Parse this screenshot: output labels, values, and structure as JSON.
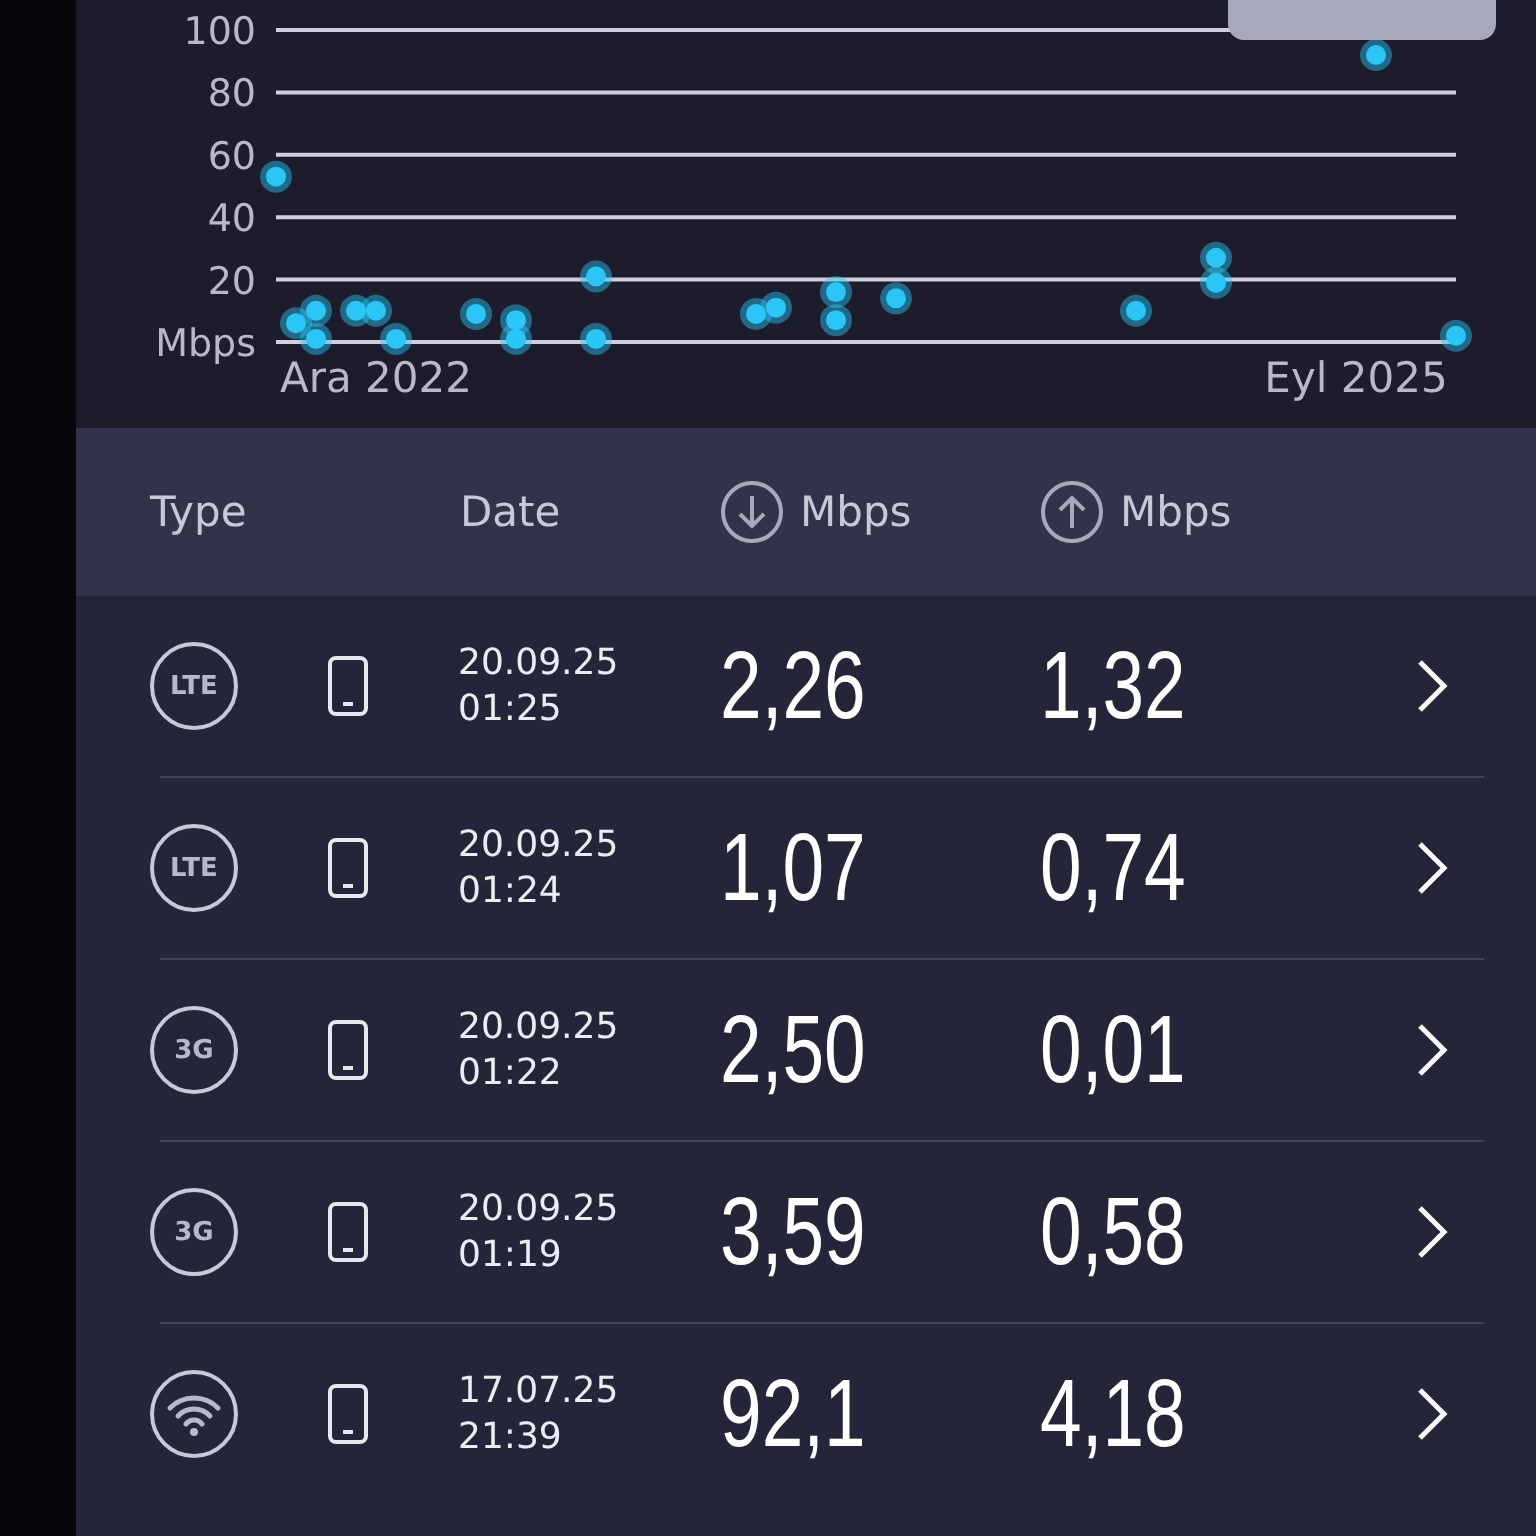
{
  "chart": {
    "chart_data": {
      "type": "scatter",
      "grid": true,
      "categories": [
        null,
        null,
        null,
        null,
        null,
        "Ara 2022",
        null,
        null,
        null,
        null,
        null,
        null,
        null,
        null,
        null,
        null,
        null,
        null,
        null,
        null,
        null,
        null,
        null,
        null,
        null,
        null,
        null,
        null,
        null,
        null,
        null,
        null,
        null,
        null,
        null,
        null,
        null,
        null,
        null,
        null,
        null,
        null,
        null,
        null,
        null,
        null,
        null,
        null,
        null,
        null,
        null,
        null,
        null,
        null,
        "Eyl 2025",
        null,
        null,
        null,
        null,
        null
      ],
      "yticks": [
        {
          "value": 0,
          "label": "Mbps"
        },
        20,
        40,
        60,
        80,
        100
      ],
      "ylim": [
        0,
        100
      ],
      "series": [
        {
          "color": "#2bc6f7",
          "values": [
            53,
            6,
            10,
            null,
            10,
            10,
            1,
            null,
            null,
            null,
            9,
            null,
            7,
            null,
            null,
            null,
            21,
            null,
            null,
            null,
            null,
            null,
            null,
            null,
            9,
            11,
            null,
            null,
            16,
            null,
            null,
            14,
            null,
            null,
            null,
            null,
            null,
            null,
            null,
            null,
            null,
            null,
            null,
            10,
            null,
            null,
            null,
            27,
            null,
            null,
            null,
            null,
            null,
            null,
            null,
            92,
            null,
            null,
            null,
            2
          ]
        },
        {
          "color": "#2bc6f7",
          "values": [
            null,
            null,
            1,
            null,
            null,
            null,
            null,
            null,
            null,
            null,
            null,
            null,
            1,
            null,
            null,
            null,
            null,
            null,
            null,
            null,
            null,
            null,
            null,
            null,
            null,
            null,
            null,
            null,
            7,
            null,
            null,
            null,
            null,
            null,
            null,
            null,
            null,
            null,
            null,
            null,
            null,
            null,
            null,
            null,
            null,
            null,
            null,
            19,
            null,
            null,
            null,
            null,
            null,
            null,
            null,
            null,
            null,
            null,
            null,
            null
          ]
        },
        {
          "color": "#2bc6f7",
          "values": [
            null,
            null,
            null,
            null,
            null,
            null,
            null,
            null,
            null,
            null,
            null,
            null,
            null,
            null,
            null,
            null,
            1,
            null,
            null,
            null,
            null,
            null,
            null,
            null,
            null,
            null,
            null,
            null,
            null,
            null,
            null,
            null,
            null,
            null,
            null,
            null,
            null,
            null,
            null,
            null,
            null,
            null,
            null,
            null,
            null,
            null,
            null,
            null,
            null,
            null,
            null,
            null,
            null,
            null,
            null,
            null,
            null,
            null,
            null,
            null
          ]
        }
      ]
    }
  },
  "table": {
    "columns": [
      {
        "label": "Type"
      },
      {
        "label": "Date"
      },
      {
        "kind": "download",
        "label": "Mbps"
      },
      {
        "kind": "upload",
        "label": "Mbps"
      }
    ],
    "rows": [
      {
        "type": {
          "kind": "badge",
          "label": "LTE"
        },
        "date": "20.09.25",
        "time": "01:25",
        "download": "2,26",
        "upload": "1,32"
      },
      {
        "type": {
          "kind": "badge",
          "label": "LTE"
        },
        "date": "20.09.25",
        "time": "01:24",
        "download": "1,07",
        "upload": "0,74"
      },
      {
        "type": {
          "kind": "badge",
          "label": "3G"
        },
        "date": "20.09.25",
        "time": "01:22",
        "download": "2,50",
        "upload": "0,01"
      },
      {
        "type": {
          "kind": "badge",
          "label": "3G"
        },
        "date": "20.09.25",
        "time": "01:19",
        "download": "3,59",
        "upload": "0,58"
      },
      {
        "type": {
          "kind": "wifi"
        },
        "date": "17.07.25",
        "time": "21:39",
        "download": "92,1",
        "upload": "4,18"
      }
    ]
  }
}
